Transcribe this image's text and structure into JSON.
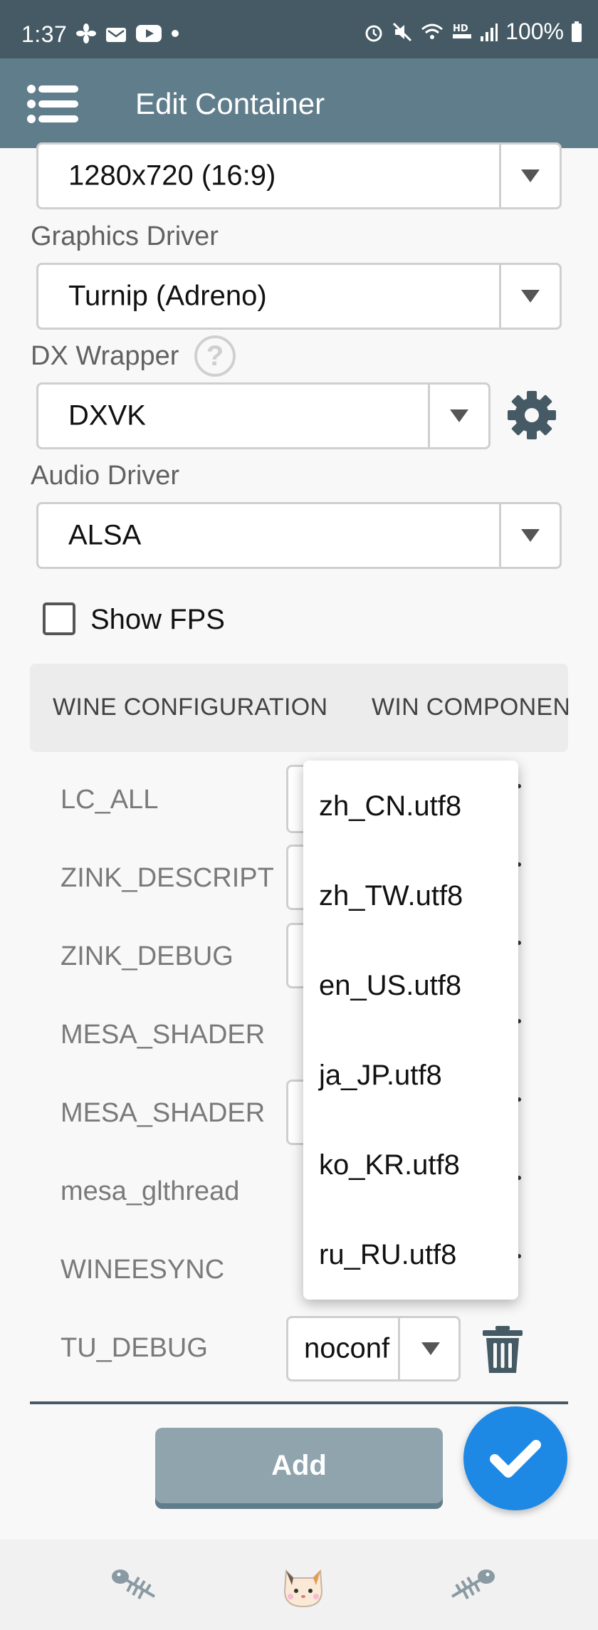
{
  "status_bar": {
    "time": "1:37",
    "battery": "100%",
    "left_icons": [
      "fan-icon",
      "mail-icon",
      "youtube-icon",
      "dot-icon"
    ],
    "right_icons": [
      "alarm-icon",
      "mute-icon",
      "wifi-icon",
      "hd-voice-icon",
      "signal-icon",
      "battery-icon"
    ]
  },
  "app_bar": {
    "title": "Edit Container"
  },
  "screen_size": {
    "value": "1280x720 (16:9)"
  },
  "graphics_driver": {
    "label": "Graphics Driver",
    "value": "Turnip (Adreno)"
  },
  "dx_wrapper": {
    "label": "DX Wrapper",
    "value": "DXVK"
  },
  "audio_driver": {
    "label": "Audio Driver",
    "value": "ALSA"
  },
  "show_fps": {
    "label": "Show FPS",
    "checked": false
  },
  "tabs": [
    {
      "label": "WINE CONFIGURATION"
    },
    {
      "label": "WIN COMPONEN"
    }
  ],
  "env_vars": [
    {
      "key": "LC_ALL"
    },
    {
      "key": "ZINK_DESCRIPT"
    },
    {
      "key": "ZINK_DEBUG"
    },
    {
      "key": "MESA_SHADER"
    },
    {
      "key": "MESA_SHADER"
    },
    {
      "key": "mesa_glthread"
    },
    {
      "key": "WINEESYNC"
    },
    {
      "key": "TU_DEBUG",
      "value": "noconf"
    }
  ],
  "locale_options": [
    "zh_CN.utf8",
    "zh_TW.utf8",
    "en_US.utf8",
    "ja_JP.utf8",
    "ko_KR.utf8",
    "ru_RU.utf8"
  ],
  "add_button": {
    "label": "Add"
  },
  "colors": {
    "status_bar": "#455a64",
    "app_bar": "#607d8b",
    "fab": "#1e88e5",
    "add_button": "#90a4ae"
  }
}
